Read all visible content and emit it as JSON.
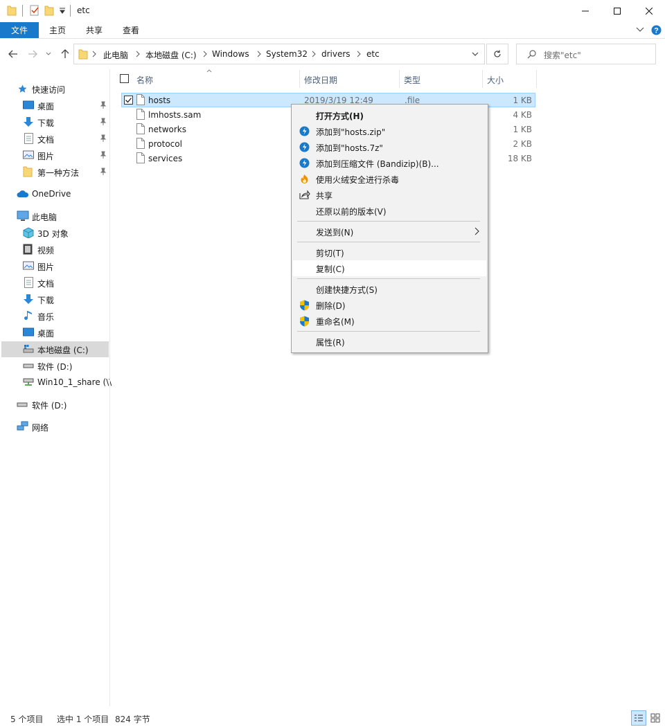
{
  "window": {
    "title": "etc",
    "minimize_icon": "minimize-icon",
    "maximize_icon": "maximize-icon",
    "close_icon": "close-icon"
  },
  "ribbon": {
    "file_tab": "文件",
    "tabs": [
      "主页",
      "共享",
      "查看"
    ],
    "help_icon": "help-icon"
  },
  "address_bar": {
    "crumbs": [
      "此电脑",
      "本地磁盘 (C:)",
      "Windows",
      "System32",
      "drivers",
      "etc"
    ]
  },
  "search": {
    "placeholder": "搜索\"etc\""
  },
  "sidebar": {
    "quick_access": "快速访问",
    "quick_items": [
      "桌面",
      "下载",
      "文档",
      "图片",
      "第一种方法"
    ],
    "onedrive": "OneDrive",
    "this_pc": "此电脑",
    "pc_items": [
      "3D 对象",
      "视频",
      "图片",
      "文档",
      "下载",
      "音乐",
      "桌面",
      "本地磁盘 (C:)",
      "软件 (D:)",
      "Win10_1_share (\\\\"
    ],
    "drive_d": "软件 (D:)",
    "network": "网络"
  },
  "columns": {
    "name": "名称",
    "date": "修改日期",
    "type": "类型",
    "size": "大小"
  },
  "files": [
    {
      "name": "hosts",
      "date": "2019/3/19 12:49",
      "type": ".file",
      "size": "1 KB",
      "selected": true
    },
    {
      "name": "lmhosts.sam",
      "size": "4 KB"
    },
    {
      "name": "networks",
      "size": "1 KB"
    },
    {
      "name": "protocol",
      "size": "2 KB"
    },
    {
      "name": "services",
      "size": "18 KB"
    }
  ],
  "context_menu": {
    "items": [
      {
        "label": "打开方式(H)",
        "icon": "",
        "bold": true
      },
      {
        "label": "添加到\"hosts.zip\"",
        "icon": "bandizip-icon"
      },
      {
        "label": "添加到\"hosts.7z\"",
        "icon": "bandizip-icon"
      },
      {
        "label": "添加到压缩文件 (Bandizip)(B)...",
        "icon": "bandizip-icon"
      },
      {
        "label": "使用火绒安全进行杀毒",
        "icon": "huorong-icon"
      },
      {
        "label": "共享",
        "icon": "share-icon"
      },
      {
        "label": "还原以前的版本(V)",
        "icon": ""
      },
      {
        "label": "发送到(N)",
        "icon": "",
        "submenu": true
      },
      {
        "label": "剪切(T)",
        "icon": ""
      },
      {
        "label": "复制(C)",
        "icon": "",
        "highlighted": true
      },
      {
        "label": "创建快捷方式(S)",
        "icon": ""
      },
      {
        "label": "删除(D)",
        "icon": "shield-icon"
      },
      {
        "label": "重命名(M)",
        "icon": "shield-icon"
      },
      {
        "label": "属性(R)",
        "icon": ""
      }
    ]
  },
  "status_bar": {
    "count": "5 个项目",
    "selection": "选中 1 个项目",
    "size": "824 字节"
  }
}
